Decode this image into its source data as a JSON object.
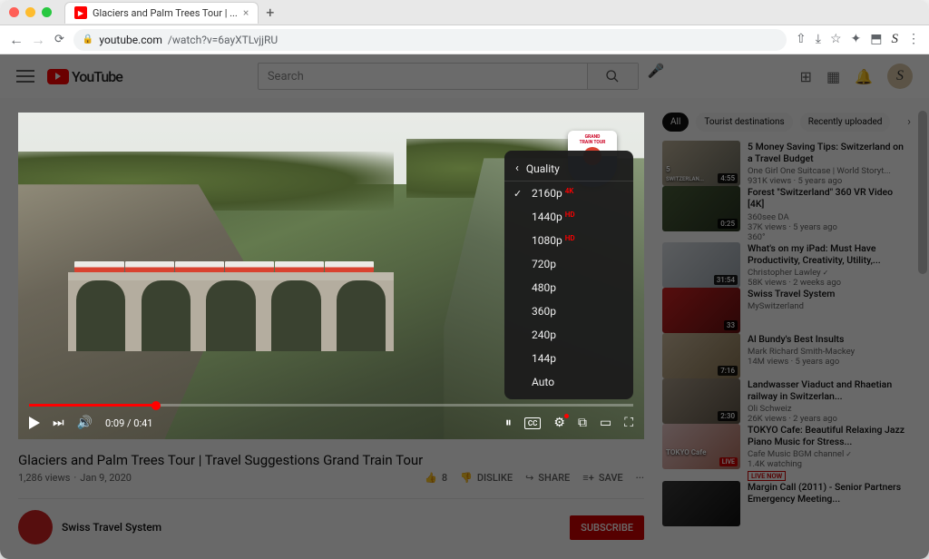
{
  "browser": {
    "tab_title": "Glaciers and Palm Trees Tour | ...",
    "url_host": "youtube.com",
    "url_path": "/watch?v=6ayXTLvjjRU"
  },
  "masthead": {
    "logo_text": "YouTube",
    "search_placeholder": "Search"
  },
  "player": {
    "time_current": "0:09",
    "time_total": "0:41",
    "badge_line1": "GRAND",
    "badge_line2": "TRAIN TOUR",
    "quality_menu": {
      "title": "Quality",
      "options": [
        {
          "label": "2160p",
          "badge": "4K",
          "selected": true
        },
        {
          "label": "1440p",
          "badge": "HD",
          "selected": false
        },
        {
          "label": "1080p",
          "badge": "HD",
          "selected": false
        },
        {
          "label": "720p",
          "badge": "",
          "selected": false
        },
        {
          "label": "480p",
          "badge": "",
          "selected": false
        },
        {
          "label": "360p",
          "badge": "",
          "selected": false
        },
        {
          "label": "240p",
          "badge": "",
          "selected": false
        },
        {
          "label": "144p",
          "badge": "",
          "selected": false
        },
        {
          "label": "Auto",
          "badge": "",
          "selected": false
        }
      ]
    }
  },
  "video": {
    "title": "Glaciers and Palm Trees Tour | Travel Suggestions Grand Train Tour",
    "views": "1,286 views",
    "date": "Jan 9, 2020",
    "likes": "8",
    "dislike_label": "DISLIKE",
    "share_label": "SHARE",
    "save_label": "SAVE",
    "channel_name": "Swiss Travel System",
    "subscribe_label": "SUBSCRIBE"
  },
  "chips": {
    "all": "All",
    "c1": "Tourist destinations",
    "c2": "Recently uploaded"
  },
  "recs": [
    {
      "title": "5 Money Saving Tips: Switzerland on a Travel Budget",
      "channel": "One Girl One Suitcase | World Storyt...",
      "stats": "931K views · 5 years ago",
      "duration": "4:55",
      "overlay": "5",
      "overlay2": "SWITZERLAN..."
    },
    {
      "title": "Forest \"Switzerland\" 360 VR Video [4K]",
      "channel": "360see DA",
      "stats": "37K views · 5 years ago",
      "duration": "0:25",
      "extra": "360°"
    },
    {
      "title": "What's on my iPad: Must Have Productivity, Creativity, Utility,...",
      "channel": "Christopher Lawley",
      "stats": "58K views · 2 weeks ago",
      "duration": "31:54",
      "verified": true
    },
    {
      "title": "Swiss Travel System",
      "channel": "MySwitzerland",
      "stats": "",
      "duration": "33",
      "is_playlist": true
    },
    {
      "title": "Al Bundy's Best Insults",
      "channel": "Mark Richard Smith-Mackey",
      "stats": "14M views · 5 years ago",
      "duration": "7:16"
    },
    {
      "title": "Landwasser Viaduct and Rhaetian railway in Switzerlan...",
      "channel": "Oli Schweiz",
      "stats": "26K views · 2 years ago",
      "duration": "2:30"
    },
    {
      "title": "TOKYO Cafe: Beautiful Relaxing Jazz Piano Music for Stress...",
      "channel": "Cafe Music BGM channel",
      "stats": "1.4K watching",
      "duration": "",
      "live": true,
      "verified": true,
      "overlay": "TOKYO Cafe"
    },
    {
      "title": "Margin Call (2011) - Senior Partners Emergency Meeting...",
      "channel": "",
      "stats": "",
      "duration": ""
    }
  ]
}
